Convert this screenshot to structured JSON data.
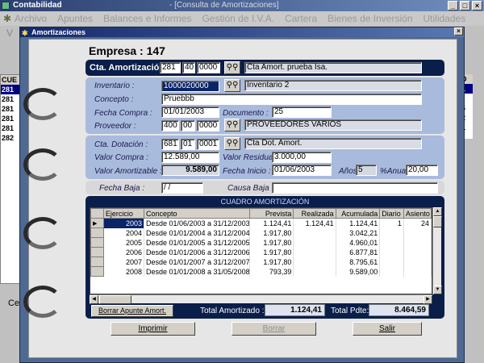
{
  "app": {
    "title": "Contabilidad",
    "doc_title": "- [Consulta de Amortizaciones]",
    "menu": [
      "Archivo",
      "Apuntes",
      "Balances e Informes",
      "Gestión de I.V.A.",
      "Cartera",
      "Bienes de Inversión",
      "Utilidades"
    ],
    "bg_left_header": "CUE",
    "bg_left_rows": [
      "281",
      "281",
      "281",
      "281",
      "281",
      "282"
    ],
    "bg_right_header": "D",
    "bg_right_rows": [
      "1",
      "6",
      "2",
      "1"
    ],
    "bg_bottom_text": "Ce",
    "bg_v": "V"
  },
  "dialog": {
    "title": "Amortizaciones",
    "empresa_label": "Empresa :",
    "empresa_value": "147",
    "cta_amort": {
      "label": "Cta. Amortización",
      "c1": "281",
      "c2": "40",
      "c3": "0000",
      "desc": "Cta Amort. prueba Isa."
    },
    "inventario": {
      "label": "Inventario :",
      "value": "1000020000",
      "desc": "Inventario 2"
    },
    "concepto": {
      "label": "Concepto :",
      "value": "Pruebbb"
    },
    "fecha_compra": {
      "label": "Fecha Compra :",
      "value": "01/01/2003"
    },
    "documento": {
      "label": "Documento :",
      "value": "25"
    },
    "proveedor": {
      "label": "Proveedor :",
      "c1": "400",
      "c2": "00",
      "c3": "0000",
      "desc": "PROVEEDORES VARIOS"
    },
    "cta_dotacion": {
      "label": "Cta. Dotación :",
      "c1": "681",
      "c2": "01",
      "c3": "0001",
      "desc": "Cta Dot. Amort."
    },
    "valor_compra": {
      "label": "Valor Compra :",
      "value": "12.589,00"
    },
    "valor_residual": {
      "label": "Valor Residual :",
      "value": "3.000,00"
    },
    "valor_amortizable": {
      "label": "Valor Amortizable :",
      "value": "9.589,00"
    },
    "fecha_inicio": {
      "label": "Fecha Inicio :",
      "value": "01/06/2003"
    },
    "anos": {
      "label": "Años",
      "value": "5"
    },
    "pct_anual": {
      "label": "%Anual",
      "value": "20,00"
    },
    "fecha_baja": {
      "label": "Fecha Baja :",
      "value": "/ /"
    },
    "causa_baja": {
      "label": "Causa Baja :",
      "value": ""
    },
    "cuadro": {
      "title": "CUADRO AMORTIZACIÓN",
      "columns": [
        "Ejercicio",
        "Concepto",
        "Prevista",
        "Realizada",
        "Acumulada",
        "Diario",
        "Asiento"
      ],
      "rows": [
        [
          "2003",
          "Desde 01/06/2003 a 31/12/2003",
          "1.124,41",
          "1.124,41",
          "1.124,41",
          "1",
          "24"
        ],
        [
          "2004",
          "Desde 01/01/2004 a 31/12/2004",
          "1.917,80",
          "",
          "3.042,21",
          "",
          ""
        ],
        [
          "2005",
          "Desde 01/01/2005 a 31/12/2005",
          "1.917,80",
          "",
          "4.960,01",
          "",
          ""
        ],
        [
          "2006",
          "Desde 01/01/2006 a 31/12/2006",
          "1.917,80",
          "",
          "6.877,81",
          "",
          ""
        ],
        [
          "2007",
          "Desde 01/01/2007 a 31/12/2007",
          "1.917,80",
          "",
          "8.795,61",
          "",
          ""
        ],
        [
          "2008",
          "Desde 01/01/2008 a 31/05/2008",
          "793,39",
          "",
          "9.589,00",
          "",
          ""
        ]
      ]
    },
    "borrar_apunte_label": "Borrar Apunte Amort.",
    "total_amortizado_label": "Total Amortizado :",
    "total_amortizado_value": "1.124,41",
    "total_pdte_label": "Total Pdte:",
    "total_pdte_value": "8.464,59",
    "buttons": {
      "imprimir": "Imprimir",
      "borrar": "Borrar",
      "salir": "Salir"
    }
  }
}
